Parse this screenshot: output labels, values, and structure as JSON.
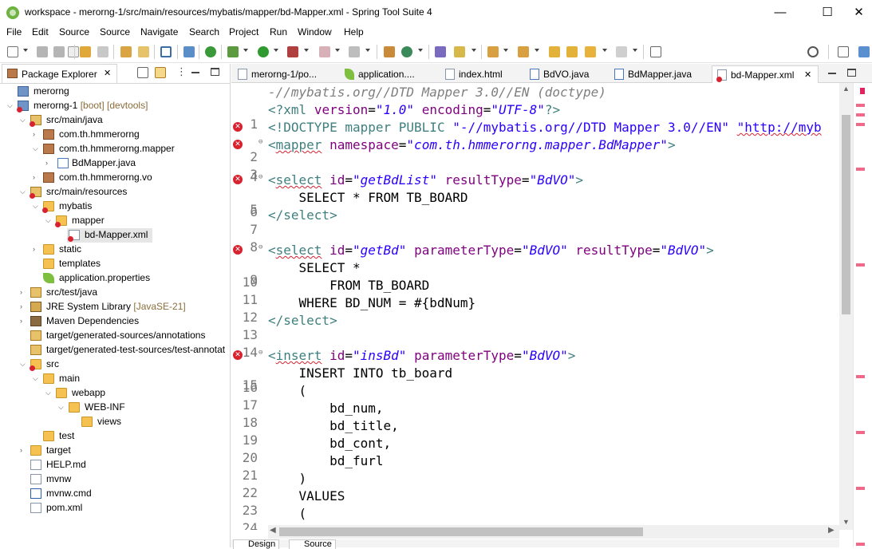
{
  "window": {
    "title": "workspace - merorng-1/src/main/resources/mybatis/mapper/bd-Mapper.xml - Spring Tool Suite 4",
    "minimize": "—",
    "maximize": "☐",
    "close": "✕"
  },
  "menu": [
    "File",
    "Edit",
    "Source",
    "Source",
    "Navigate",
    "Search",
    "Project",
    "Run",
    "Window",
    "Help"
  ],
  "explorer": {
    "tab_label": "Package Explorer",
    "close_icon": "✕",
    "tree": [
      {
        "label": "merorng",
        "deco": ""
      },
      {
        "label": "merorng-1",
        "deco": " [boot] [devtools]"
      },
      {
        "label": "src/main/java",
        "deco": ""
      },
      {
        "label": "com.th.hmmerorng",
        "deco": ""
      },
      {
        "label": "com.th.hmmerorng.mapper",
        "deco": ""
      },
      {
        "label": "BdMapper.java",
        "deco": ""
      },
      {
        "label": "com.th.hmmerorng.vo",
        "deco": ""
      },
      {
        "label": "src/main/resources",
        "deco": ""
      },
      {
        "label": "mybatis",
        "deco": ""
      },
      {
        "label": "mapper",
        "deco": ""
      },
      {
        "label": "bd-Mapper.xml",
        "deco": ""
      },
      {
        "label": "static",
        "deco": ""
      },
      {
        "label": "templates",
        "deco": ""
      },
      {
        "label": "application.properties",
        "deco": ""
      },
      {
        "label": "src/test/java",
        "deco": ""
      },
      {
        "label": "JRE System Library",
        "deco": " [JavaSE-21]"
      },
      {
        "label": "Maven Dependencies",
        "deco": ""
      },
      {
        "label": "target/generated-sources/annotations",
        "deco": ""
      },
      {
        "label": "target/generated-test-sources/test-annotat",
        "deco": ""
      },
      {
        "label": "src",
        "deco": ""
      },
      {
        "label": "main",
        "deco": ""
      },
      {
        "label": "webapp",
        "deco": ""
      },
      {
        "label": "WEB-INF",
        "deco": ""
      },
      {
        "label": "views",
        "deco": ""
      },
      {
        "label": "test",
        "deco": ""
      },
      {
        "label": "target",
        "deco": ""
      },
      {
        "label": "HELP.md",
        "deco": ""
      },
      {
        "label": "mvnw",
        "deco": ""
      },
      {
        "label": "mvnw.cmd",
        "deco": ""
      },
      {
        "label": "pom.xml",
        "deco": ""
      }
    ]
  },
  "editor": {
    "tabs": [
      "merorng-1/po...",
      "application....",
      "index.html",
      "BdVO.java",
      "BdMapper.java",
      "bd-Mapper.xml"
    ],
    "active_tab_close": "✕",
    "top_partial": "-//mybatis.org//DTD Mapper 3.0//EN (doctype)",
    "line_numbers": [
      "1",
      "2",
      "3",
      "4",
      "5",
      "6",
      "7",
      "8",
      "9",
      "10",
      "11",
      "12",
      "13",
      "14",
      "15",
      "16",
      "17",
      "18",
      "19",
      "20",
      "21",
      "22",
      "23",
      "24"
    ],
    "bottom_tabs": [
      "Design",
      "Source"
    ]
  }
}
